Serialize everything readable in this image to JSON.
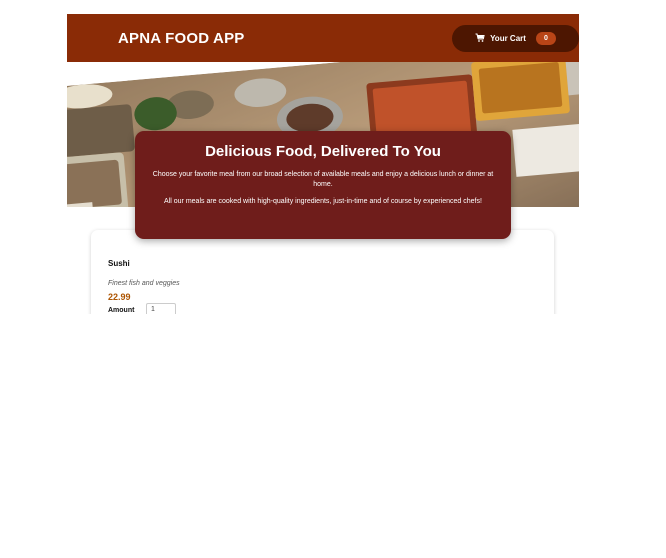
{
  "header": {
    "app_title": "APNA FOOD APP",
    "cart_label": "Your Cart",
    "cart_count": "0"
  },
  "icons": {
    "cart": "shopping-cart-icon"
  },
  "colors": {
    "header_bg": "#8a2b06",
    "cart_bg": "#4d1601",
    "badge_bg": "#b94517",
    "summary_bg": "#6f1d1b",
    "price": "#ad5502"
  },
  "summary": {
    "title": "Delicious Food, Delivered To You",
    "paragraph_1": "Choose your favorite meal from our broad selection of available meals and enjoy a delicious lunch or dinner at home.",
    "paragraph_2": "All our meals are cooked with high-quality ingredients, just-in-time and of course by experienced chefs!"
  },
  "meals": [
    {
      "name": "Sushi",
      "description": "Finest fish and veggies",
      "price": "22.99",
      "amount_label": "Amount",
      "amount_value": "1"
    }
  ]
}
